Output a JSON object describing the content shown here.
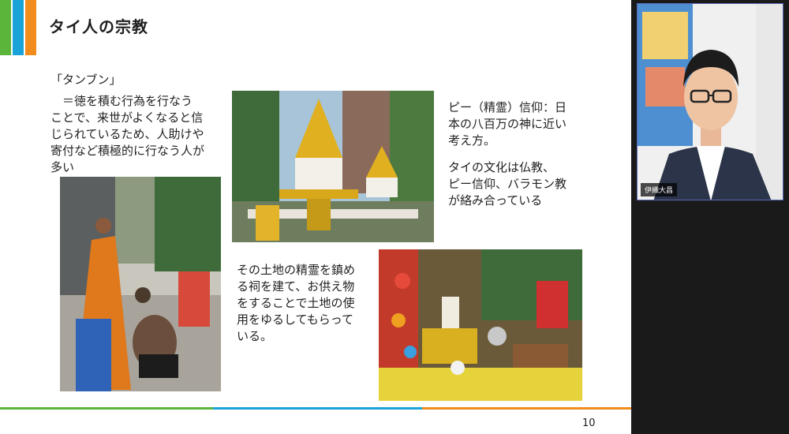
{
  "slide": {
    "title": "タイ人の宗教",
    "heading": "「タンブン」",
    "tambun_lines": [
      "　＝徳を積む行為を行なう",
      "ことで、来世がよくなると信",
      "じられているため、人助けや",
      "寄付など積極的に行なう人が",
      "多い"
    ],
    "phi_lines": [
      "ピー（精霊）信仰：日",
      "本の八百万の神に近い",
      "考え方。"
    ],
    "culture_lines": [
      "タイの文化は仏教、",
      "ピー信仰、バラモン教",
      "が絡み合っている"
    ],
    "shrine_lines": [
      "その土地の精霊を鎮め",
      "る祠を建て、お供え物",
      "をすることで土地の使",
      "用をゆるしてもらって",
      "いる。"
    ],
    "page_number": "10"
  },
  "participant": {
    "name": "伊織大昌"
  },
  "colors": {
    "accent_green": "#5bb53a",
    "accent_blue": "#1aa3d9",
    "accent_orange": "#f28c1c",
    "video_border": "#5a6ab8"
  }
}
